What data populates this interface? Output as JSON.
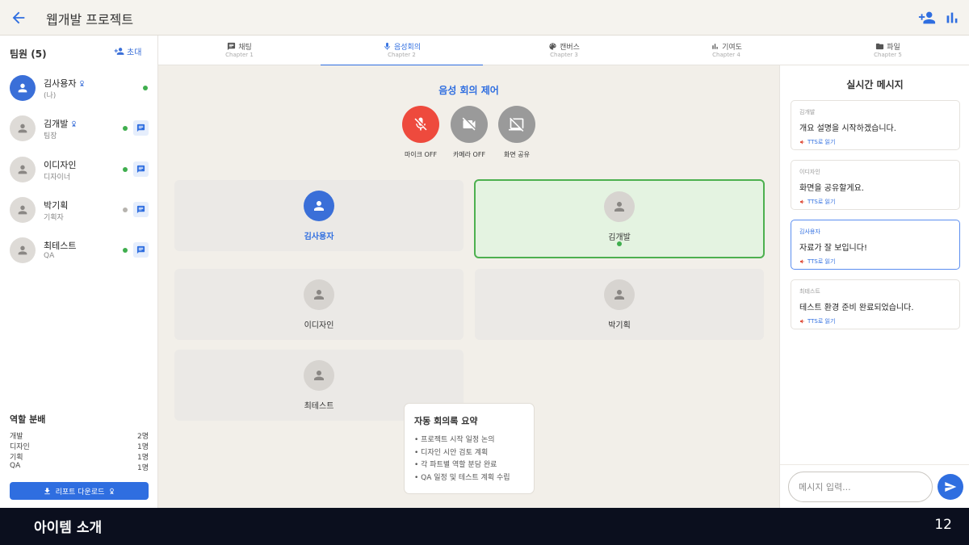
{
  "header": {
    "title": "웹개발 프로젝트",
    "back_icon": "arrow-left-icon",
    "add_member_icon": "person-add-icon",
    "stats_icon": "bar-chart-icon"
  },
  "members_panel": {
    "title": "팀원 (5)",
    "invite_label": "초대",
    "members": [
      {
        "name": "김사용자",
        "role": "(나)",
        "badge": true,
        "status": "online",
        "is_me": true
      },
      {
        "name": "김개발",
        "role": "팀장",
        "badge": true,
        "status": "online"
      },
      {
        "name": "이디자인",
        "role": "디자이너",
        "badge": false,
        "status": "online"
      },
      {
        "name": "박기획",
        "role": "기획자",
        "badge": false,
        "status": "offline"
      },
      {
        "name": "최테스트",
        "role": "QA",
        "badge": false,
        "status": "online"
      }
    ],
    "role_distribution": {
      "title": "역할 분배",
      "rows": [
        {
          "role": "개발",
          "count": "2명"
        },
        {
          "role": "디자인",
          "count": "1명"
        },
        {
          "role": "기획",
          "count": "1명"
        },
        {
          "role": "QA",
          "count": "1명"
        }
      ]
    },
    "report_button": "리포트 다운로드"
  },
  "tabs": [
    {
      "label": "채팅",
      "sub": "Chapter 1",
      "icon": "chat-icon"
    },
    {
      "label": "음성회의",
      "sub": "Chapter 2",
      "icon": "mic-icon",
      "active": true
    },
    {
      "label": "캔버스",
      "sub": "Chapter 3",
      "icon": "palette-icon"
    },
    {
      "label": "기여도",
      "sub": "Chapter 4",
      "icon": "bar-chart-icon"
    },
    {
      "label": "파일",
      "sub": "Chapter 5",
      "icon": "folder-icon"
    }
  ],
  "voice": {
    "title": "음성 회의 제어",
    "controls": [
      {
        "label": "마이크 OFF",
        "icon": "mic-off-icon",
        "color": "#ee4a3d"
      },
      {
        "label": "카메라 OFF",
        "icon": "videocam-off-icon",
        "color": "#9a9a9a"
      },
      {
        "label": "화면 공유",
        "icon": "screen-share-off-icon",
        "color": "#9a9a9a"
      }
    ],
    "participants": [
      {
        "name": "김사용자",
        "is_me": true
      },
      {
        "name": "김개발",
        "speaking": true
      },
      {
        "name": "이디자인"
      },
      {
        "name": "박기획"
      },
      {
        "name": "최테스트"
      }
    ],
    "summary": {
      "title": "자동 회의록 요약",
      "items": [
        "• 프로젝트 시작 일정 논의",
        "• 디자인 시안 검토 계획",
        "• 각 파트별 역할 분담 완료",
        "• QA 일정 및 테스트 계획 수립"
      ]
    }
  },
  "messages_panel": {
    "title": "실시간 메시지",
    "tts_label": "TTS로 읽기",
    "messages": [
      {
        "sender": "김개발",
        "text": "개요 설명을 시작하겠습니다."
      },
      {
        "sender": "이디자인",
        "text": "화면을 공유할게요."
      },
      {
        "sender": "김사용자",
        "text": "자료가 잘 보입니다!",
        "mine": true
      },
      {
        "sender": "최테스트",
        "text": "테스트 환경 준비 완료되었습니다."
      }
    ],
    "input_placeholder": "메시지 입력..."
  },
  "footer": {
    "title": "아이템 소개",
    "page": "12"
  },
  "colors": {
    "accent": "#2f6ee0",
    "online": "#3fae4e",
    "mic_off": "#ee4a3d",
    "speaking_bg": "#e4f3e1",
    "footer_bg": "#0b0f1e"
  }
}
